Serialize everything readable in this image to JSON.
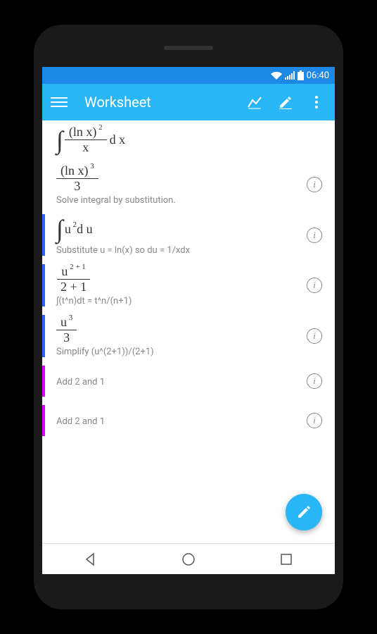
{
  "statusbar": {
    "time": "06:40"
  },
  "appbar": {
    "title": "Worksheet"
  },
  "steps": [
    {
      "accent": "",
      "math_html": "integral (ln x)^2 / x dx",
      "explain": "",
      "info": false
    },
    {
      "accent": "",
      "result_html": "(ln x)^3 / 3",
      "explain": "Solve integral by substitution.",
      "info": true
    },
    {
      "accent": "blue",
      "math_html": "∫ u^2 du",
      "explain": "Substitute u = ln(x) so du = 1/xdx",
      "info": true
    },
    {
      "accent": "blue",
      "math_html": "u^(2+1) / (2+1)",
      "explain": "∫(t^n)dt = t^n/(n+1)",
      "info": true
    },
    {
      "accent": "blue",
      "math_html": "u^3 / 3",
      "explain": "Simplify (u^(2+1))/(2+1)",
      "info": true
    },
    {
      "accent": "magenta",
      "explain_only": "Add 2 and 1",
      "info": true
    },
    {
      "accent": "magenta",
      "explain_only": "Add 2 and 1",
      "info": true
    }
  ],
  "icons": {
    "info_glyph": "i",
    "nav_back": "back",
    "nav_home": "home",
    "nav_recent": "recent"
  }
}
